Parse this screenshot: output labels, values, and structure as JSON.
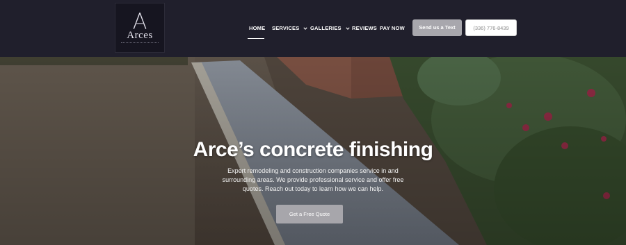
{
  "brand": {
    "logo_letter": "A",
    "logo_name": "Arces"
  },
  "nav": {
    "items": [
      {
        "label": "HOME",
        "has_dropdown": false,
        "active": true
      },
      {
        "label": "SERVICES",
        "has_dropdown": true,
        "active": false
      },
      {
        "label": "GALLERIES",
        "has_dropdown": true,
        "active": false
      },
      {
        "label": "REVIEWS",
        "has_dropdown": false,
        "active": false
      },
      {
        "label": "PAY NOW",
        "has_dropdown": false,
        "active": false
      }
    ]
  },
  "header_buttons": {
    "text_label": "Send us a Text",
    "phone_label": "(336) 776-8439"
  },
  "hero": {
    "title": "Arce’s concrete finishing",
    "description": "Expert remodeling and construction companies service in and surrounding areas. We provide professional service and offer free quotes. Reach out today to learn how we can help.",
    "cta_label": "Get a Free Quote"
  },
  "colors": {
    "header_bg": "#201f2c",
    "button_gray": "#a8a7ad",
    "text_white": "#ffffff"
  }
}
